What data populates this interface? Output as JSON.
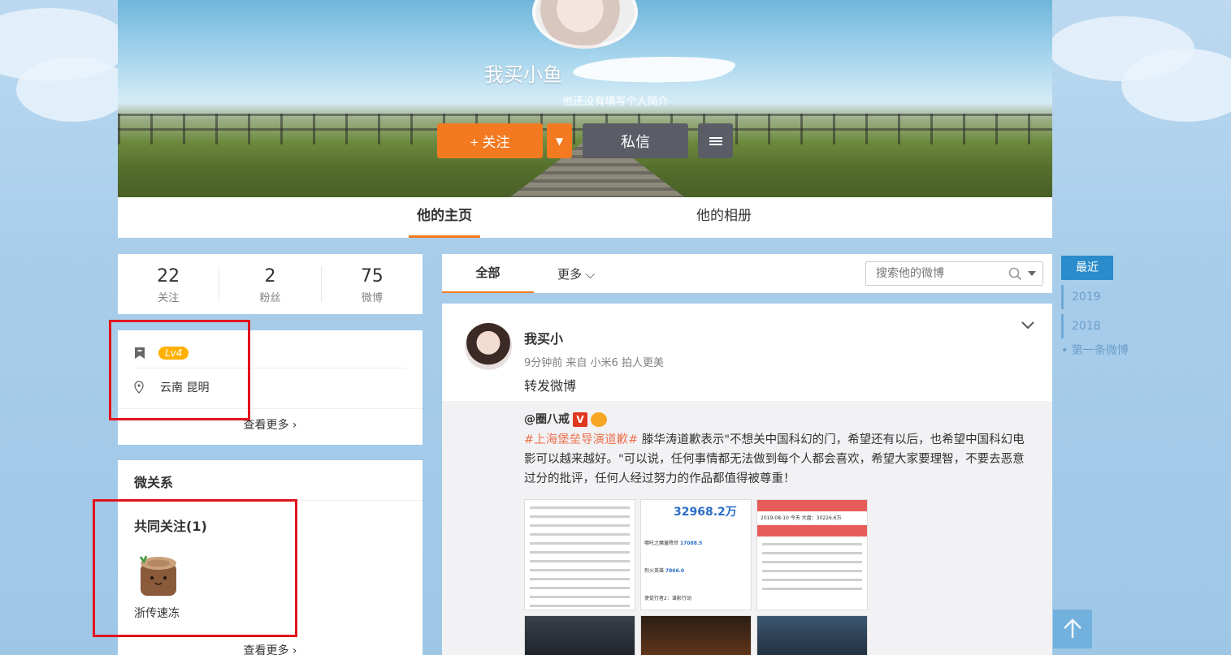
{
  "profile": {
    "nickname": "我买小鱼",
    "bio": "他还没有填写个人简介",
    "follow_label": "+ 关注",
    "dropdown_glyph": "▼",
    "message_label": "私信"
  },
  "tabs": [
    {
      "label": "他的主页",
      "active": true
    },
    {
      "label": "他的相册",
      "active": false
    }
  ],
  "stats": [
    {
      "value": "22",
      "label": "关注"
    },
    {
      "value": "2",
      "label": "粉丝"
    },
    {
      "value": "75",
      "label": "微博"
    }
  ],
  "info": {
    "level": "Lv4",
    "location": "云南 昆明",
    "more": "查看更多 ›"
  },
  "relations": {
    "title": "微关系",
    "common_follow": "共同关注(1)",
    "user": "浙传速冻",
    "more": "查看更多 ›"
  },
  "filter": {
    "all": "全部",
    "more": "更多 ⌵",
    "search_placeholder": "搜索他的微博"
  },
  "post": {
    "author": "我买小",
    "meta": "9分钟前 来自 小米6 拍人更美",
    "text": "转发微博",
    "repost": {
      "author": "@圈八戒",
      "hashtag": "#上海堡垒导演道歉#",
      "body": " 滕华涛道歉表示\"不想关中国科幻的门，希望还有以后，也希望中国科幻电影可以越来越好。\"可以说，任何事情都无法做到每个人都会喜欢，希望大家要理智，不要去恶意过分的批评，任何人经过努力的作品都值得被尊重！",
      "box_office": "32968.2",
      "box_office_unit": "万",
      "box_office_date": "2019-08-10 今天 大盘：30226.6万",
      "box_office_rows": [
        {
          "film": "哪吒之魔童降世",
          "value": "17088.5"
        },
        {
          "film": "烈火英雄",
          "value": "7866.0"
        },
        {
          "film": "使徒行者2：谍影行动",
          "value": ""
        }
      ]
    }
  },
  "timeline": {
    "now": "最近",
    "years": [
      "2019",
      "2018"
    ],
    "first": "第一条微博"
  },
  "colors": {
    "accent": "#f37a21",
    "dark_button": "#5a5d66",
    "timeline": "#2a8ccb",
    "highlight_box": "#e0141e"
  }
}
